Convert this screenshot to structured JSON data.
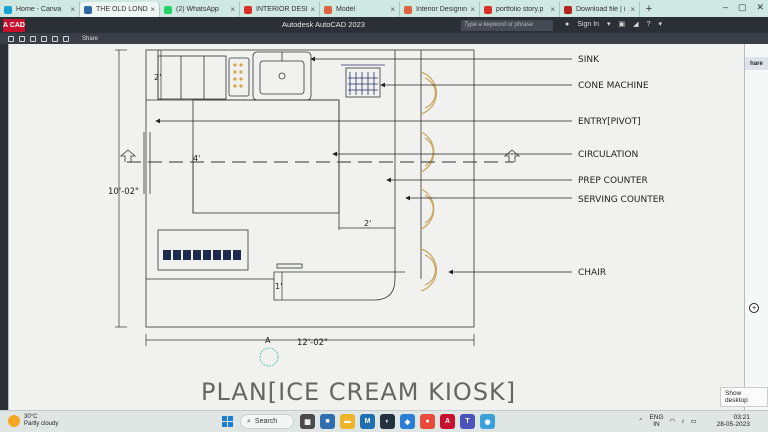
{
  "browser": {
    "tabs": [
      {
        "label": "Home - Canva",
        "icon_color": "#19a3d3",
        "active": false
      },
      {
        "label": "THE OLD LONDON",
        "icon_color": "#2e6aa8",
        "active": true
      },
      {
        "label": "(2) WhatsApp",
        "icon_color": "#25d366",
        "active": false
      },
      {
        "label": "INTERIOR DESIGN",
        "icon_color": "#d93025",
        "active": false
      },
      {
        "label": "Model",
        "icon_color": "#e0613a",
        "active": false
      },
      {
        "label": "Interior Designin",
        "icon_color": "#e0613a",
        "active": false
      },
      {
        "label": "portfolio story.p",
        "icon_color": "#d93025",
        "active": false
      },
      {
        "label": "Download file | i",
        "icon_color": "#b3261e",
        "active": false
      }
    ],
    "new_tab": "+"
  },
  "autocad": {
    "logo": "A CAD",
    "title": "Autodesk AutoCAD 2023",
    "search_placeholder": "Type a keyword or phrase",
    "sign_in": "Sign In",
    "share": "Share",
    "share_side": "hare"
  },
  "drawing": {
    "labels": {
      "sink": "SINK",
      "cone_machine": "CONE MACHINE",
      "entry": "ENTRY[PIVOT]",
      "circulation": "CIRCULATION",
      "prep_counter": "PREP COUNTER",
      "serving_counter": "SERVING COUNTER",
      "chair": "CHAIR"
    },
    "dimensions": {
      "d_2_top": "2'",
      "d_4": "4'",
      "d_2_right": "2'",
      "d_1": "1'",
      "height": "10'-02\"",
      "width": "12'-02\"",
      "section_mark": "A"
    },
    "title": "PLAN[ICE CREAM KIOSK]"
  },
  "tooltip": "Show desktop",
  "taskbar": {
    "weather_temp": "30°C",
    "weather_desc": "Partly cloudy",
    "search": "Search",
    "lang_top": "ENG",
    "lang_bottom": "IN",
    "time": "03:21",
    "date": "28-05-2023"
  }
}
